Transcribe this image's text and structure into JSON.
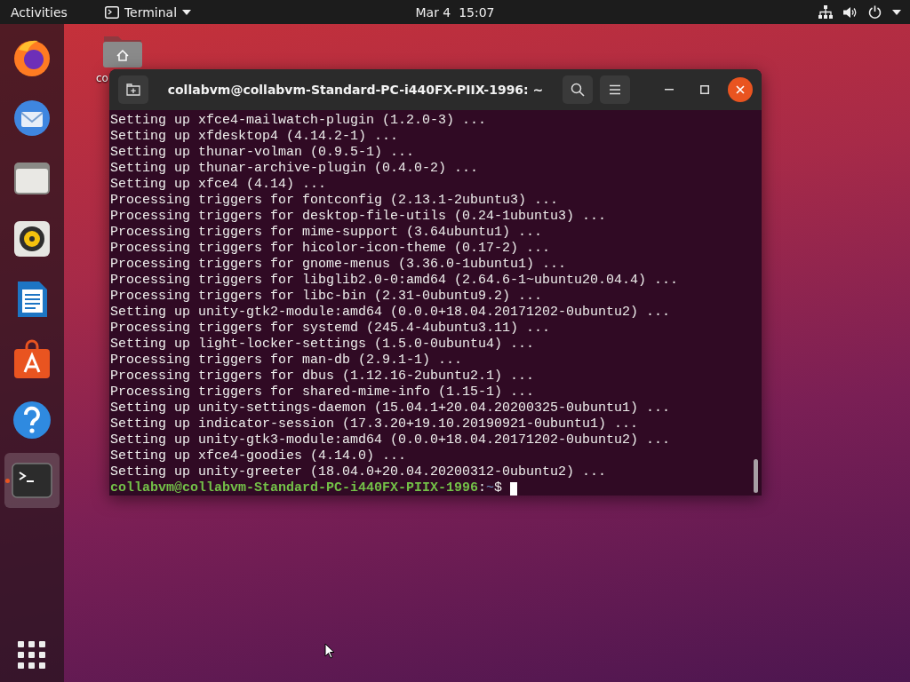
{
  "top_bar": {
    "activities": "Activities",
    "app_menu": {
      "label": "Terminal"
    },
    "clock": "Mar 4  15:07"
  },
  "dock": {
    "apps": [
      {
        "kind": "browser",
        "selected": false,
        "running": false
      },
      {
        "kind": "mail",
        "selected": false,
        "running": false
      },
      {
        "kind": "files",
        "selected": false,
        "running": false
      },
      {
        "kind": "music",
        "selected": false,
        "running": false
      },
      {
        "kind": "writer",
        "selected": false,
        "running": false
      },
      {
        "kind": "store",
        "selected": false,
        "running": false
      },
      {
        "kind": "help",
        "selected": false,
        "running": false
      },
      {
        "kind": "terminal",
        "selected": true,
        "running": true
      }
    ]
  },
  "desktop_icons": [
    {
      "label": "co"
    }
  ],
  "terminal": {
    "title": "collabvm@collabvm-Standard-PC-i440FX-PIIX-1996: ~",
    "lines": [
      "Setting up xfce4-mailwatch-plugin (1.2.0-3) ...",
      "Setting up xfdesktop4 (4.14.2-1) ...",
      "Setting up thunar-volman (0.9.5-1) ...",
      "Setting up thunar-archive-plugin (0.4.0-2) ...",
      "Setting up xfce4 (4.14) ...",
      "Processing triggers for fontconfig (2.13.1-2ubuntu3) ...",
      "Processing triggers for desktop-file-utils (0.24-1ubuntu3) ...",
      "Processing triggers for mime-support (3.64ubuntu1) ...",
      "Processing triggers for hicolor-icon-theme (0.17-2) ...",
      "Processing triggers for gnome-menus (3.36.0-1ubuntu1) ...",
      "Processing triggers for libglib2.0-0:amd64 (2.64.6-1~ubuntu20.04.4) ...",
      "Processing triggers for libc-bin (2.31-0ubuntu9.2) ...",
      "Setting up unity-gtk2-module:amd64 (0.0.0+18.04.20171202-0ubuntu2) ...",
      "Processing triggers for systemd (245.4-4ubuntu3.11) ...",
      "Setting up light-locker-settings (1.5.0-0ubuntu4) ...",
      "Processing triggers for man-db (2.9.1-1) ...",
      "Processing triggers for dbus (1.12.16-2ubuntu2.1) ...",
      "Processing triggers for shared-mime-info (1.15-1) ...",
      "Setting up unity-settings-daemon (15.04.1+20.04.20200325-0ubuntu1) ...",
      "Setting up indicator-session (17.3.20+19.10.20190921-0ubuntu1) ...",
      "Setting up unity-gtk3-module:amd64 (0.0.0+18.04.20171202-0ubuntu2) ...",
      "Setting up xfce4-goodies (4.14.0) ...",
      "Setting up unity-greeter (18.04.0+20.04.20200312-0ubuntu2) ..."
    ],
    "prompt": {
      "user_host": "collabvm@collabvm-Standard-PC-i440FX-PIIX-1996",
      "separator": ":",
      "path": "~",
      "symbol": "$"
    }
  }
}
